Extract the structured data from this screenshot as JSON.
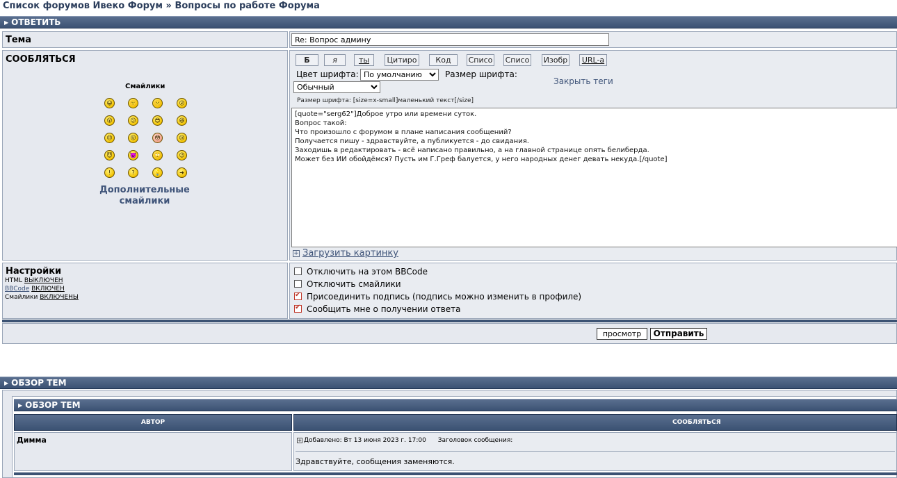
{
  "breadcrumbs": {
    "forum_list": "Список форумов Ивеко Форум",
    "separator": "»",
    "forum": "Вопросы по работе Форума"
  },
  "reply_header": "ОТВЕТИТЬ",
  "subject": {
    "label": "Тема",
    "value": "Re: Вопрос админу"
  },
  "message": {
    "label": "СООБЛЯТЬСЯ",
    "smilies_title": "Смайлики",
    "more_smilies": "Дополнительные смайлики",
    "smilies": [
      {
        "icon": "grin-smiley",
        "glyph": "😀"
      },
      {
        "icon": "smile-smiley",
        "glyph": "🙂"
      },
      {
        "icon": "sad-smiley",
        "glyph": "🙁"
      },
      {
        "icon": "surprised-smiley",
        "glyph": "😮"
      },
      {
        "icon": "shocked-smiley",
        "glyph": "😲"
      },
      {
        "icon": "confused-smiley",
        "glyph": "😕"
      },
      {
        "icon": "cool-smiley",
        "glyph": "😎"
      },
      {
        "icon": "laugh-smiley",
        "glyph": "😆"
      },
      {
        "icon": "mad-smiley",
        "glyph": "😠"
      },
      {
        "icon": "razz-smiley",
        "glyph": "😛"
      },
      {
        "icon": "embarrassed-smiley",
        "glyph": "😳"
      },
      {
        "icon": "crying-smiley",
        "glyph": "😢"
      },
      {
        "icon": "evil-smiley",
        "glyph": "😈"
      },
      {
        "icon": "twisted-evil-smiley",
        "glyph": "👿"
      },
      {
        "icon": "rolling-eyes-smiley",
        "glyph": "🙄"
      },
      {
        "icon": "wink-smiley",
        "glyph": "😉"
      },
      {
        "icon": "exclamation-smiley",
        "glyph": "!"
      },
      {
        "icon": "question-smiley",
        "glyph": "?"
      },
      {
        "icon": "idea-smiley",
        "glyph": "💡"
      },
      {
        "icon": "arrow-smiley",
        "glyph": "➜"
      }
    ],
    "bbcode_buttons": [
      "Б",
      "я",
      "ты",
      "Цитиро",
      "Код",
      "Списо",
      "Списо",
      "Изобр",
      "URL-а"
    ],
    "font_color_label": "Цвет шрифта:",
    "font_color_value": "По умолчанию",
    "font_size_label": "Размер шрифта:",
    "font_size_value": "Обычный",
    "close_tags": "Закрыть теги",
    "size_hint": "Размер шрифта: [size=x-small]маленький текст[/size]",
    "body": "[quote=\"serg62\"]Доброе утро или времени суток.\nВопрос такой:\nЧто произошло с форумом в плане написания сообщений?\nПолучается пишу - здравствуйте, а публикуется - до свидания.\nЗаходишь в редактировать - всё написано правильно, а на главной странице опять белиберда.\nМожет без ИИ обойдёмся? Пусть им Г.Греф балуется, у него народных денег девать некуда.[/quote]",
    "upload_label": "Загрузить картинку"
  },
  "settings": {
    "label": "Настройки",
    "html_label": "HTML",
    "html_value": "ВЫКЛЮЧЕН",
    "bbcode_label": "BBCode",
    "bbcode_value": "ВКЛЮЧЕН",
    "smilies_label": "Смайлики",
    "smilies_value": "ВКЛЮЧЕНЫ",
    "options": [
      {
        "label": "Отключить на этом BBCode",
        "checked": false
      },
      {
        "label": "Отключить смайлики",
        "checked": false
      },
      {
        "label": "Присоединить подпись (подпись можно изменить в профиле)",
        "checked": true
      },
      {
        "label": "Сообщить мне о получении ответа",
        "checked": true
      }
    ]
  },
  "buttons": {
    "preview": "просмотр",
    "submit": "Отправить"
  },
  "topic_review": {
    "header": "ОБЗОР ТЕМ",
    "inner_header": "ОБЗОР ТЕМ",
    "col_author": "АВТОР",
    "col_message": "СООБЛЯТЬСЯ",
    "posts": [
      {
        "author": "Димма",
        "posted": "Добавлено: Вт 13 июня 2023 г. 17:00",
        "subject_label": "Заголовок сообщения:",
        "text": "Здравствуйте, сообщения заменяются."
      }
    ]
  },
  "colors": {
    "header_bg": "#3b5273",
    "cell_bg": "#e6e9ef",
    "link": "#3f5479"
  }
}
